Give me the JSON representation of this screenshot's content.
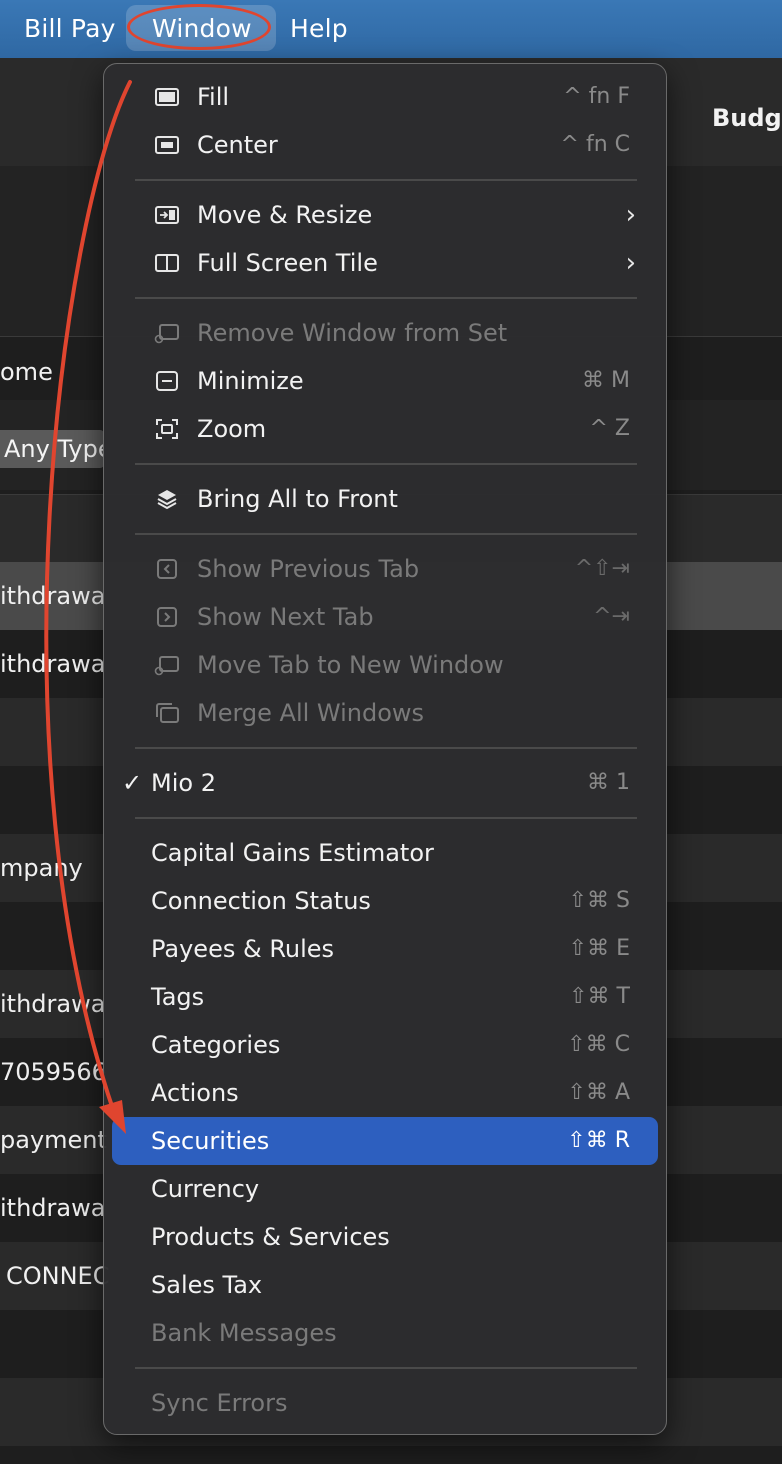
{
  "menubar": {
    "items": [
      "Bill Pay",
      "Window",
      "Help"
    ]
  },
  "background": {
    "toolbar_label": "Budge",
    "rows": [
      "ome",
      "Any Type",
      "ithdrawa",
      "ithdrawa",
      "mpany",
      "ithdrawa",
      "7059566",
      "payment",
      "ithdrawa",
      "CONNEC"
    ]
  },
  "menu": {
    "fill": {
      "label": "Fill",
      "shortcut": "^ fn F"
    },
    "center": {
      "label": "Center",
      "shortcut": "^ fn C"
    },
    "move_resize": {
      "label": "Move & Resize"
    },
    "full_screen_tile": {
      "label": "Full Screen Tile"
    },
    "remove_window": {
      "label": "Remove Window from Set"
    },
    "minimize": {
      "label": "Minimize",
      "shortcut": "⌘ M"
    },
    "zoom": {
      "label": "Zoom",
      "shortcut": "^ Z"
    },
    "bring_all": {
      "label": "Bring All to Front"
    },
    "prev_tab": {
      "label": "Show Previous Tab",
      "shortcut": "^⇧⇥"
    },
    "next_tab": {
      "label": "Show Next Tab",
      "shortcut": "^⇥"
    },
    "move_tab": {
      "label": "Move Tab to New Window"
    },
    "merge": {
      "label": "Merge All Windows"
    },
    "mio": {
      "label": "Mio 2",
      "shortcut": "⌘ 1",
      "check": "✓"
    },
    "capital_gains": {
      "label": "Capital Gains Estimator"
    },
    "connection_status": {
      "label": "Connection Status",
      "shortcut": "⇧⌘ S"
    },
    "payees_rules": {
      "label": "Payees & Rules",
      "shortcut": "⇧⌘ E"
    },
    "tags": {
      "label": "Tags",
      "shortcut": "⇧⌘ T"
    },
    "categories": {
      "label": "Categories",
      "shortcut": "⇧⌘ C"
    },
    "actions": {
      "label": "Actions",
      "shortcut": "⇧⌘ A"
    },
    "securities": {
      "label": "Securities",
      "shortcut": "⇧⌘ R"
    },
    "currency": {
      "label": "Currency"
    },
    "products_services": {
      "label": "Products & Services"
    },
    "sales_tax": {
      "label": "Sales Tax"
    },
    "bank_messages": {
      "label": "Bank Messages"
    },
    "sync_errors": {
      "label": "Sync Errors"
    }
  },
  "colors": {
    "highlight": "#2d5fbf",
    "annotation": "#e0452f",
    "menubar": "#3572b0"
  }
}
